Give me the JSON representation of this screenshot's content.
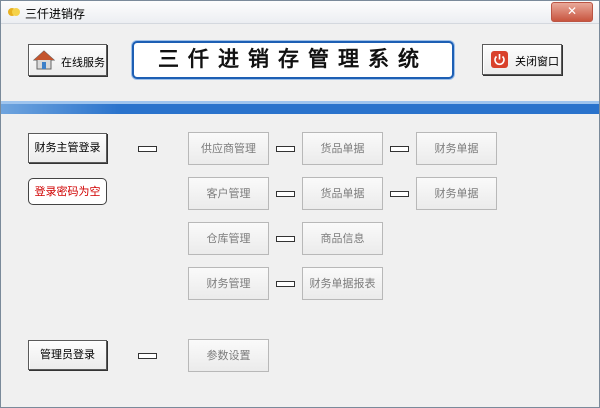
{
  "window": {
    "title": "三仟进销存",
    "close_glyph": "✕"
  },
  "header": {
    "online_service": "在线服务",
    "system_title": "三仟进销存管理系统",
    "close_window": "关闭窗口"
  },
  "left": {
    "finance_login": "财务主管登录",
    "password_hint": "登录密码为空",
    "admin_login": "管理员登录"
  },
  "grid": {
    "supplier": "供应商管理",
    "goods_doc_1": "货品单据",
    "finance_doc_1": "财务单据",
    "customer": "客户管理",
    "goods_doc_2": "货品单据",
    "finance_doc_2": "财务单据",
    "warehouse": "仓库管理",
    "product_info": "商品信息",
    "finance_mgmt": "财务管理",
    "finance_report": "财务单据报表",
    "params": "参数设置"
  },
  "colors": {
    "accent_blue": "#2a73cc",
    "hint_red": "#d00000",
    "close_red": "#c8553f"
  },
  "icons": {
    "app": "app-icon",
    "home": "home-icon",
    "power": "power-icon",
    "close": "close-icon"
  }
}
